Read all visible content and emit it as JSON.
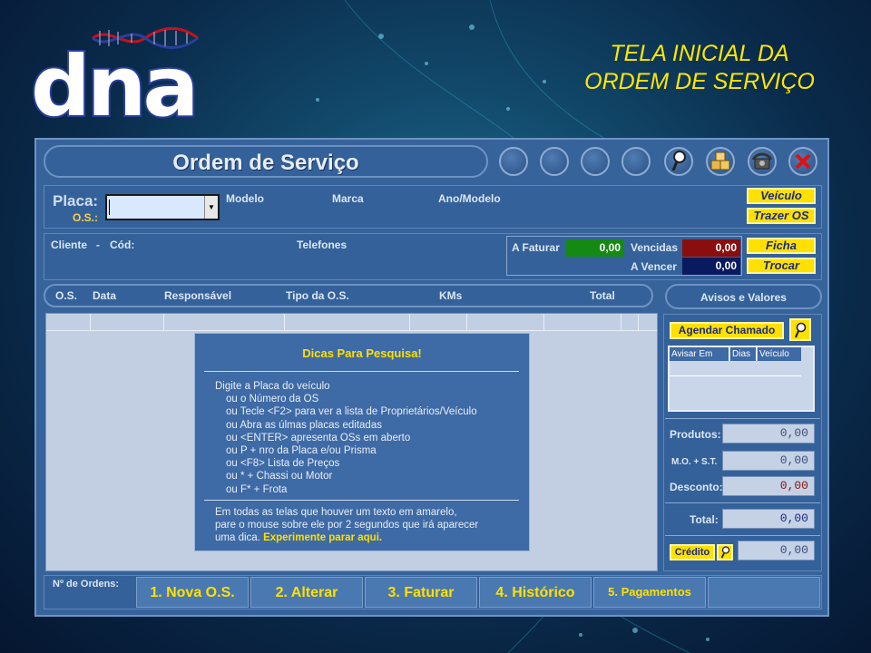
{
  "colors": {
    "accent_yellow": "#ffe000",
    "window_blue": "#37639b",
    "ok_green": "#148a14",
    "danger_red": "#8a0e0e",
    "navy": "#0a1a5e"
  },
  "logo": {
    "text": "dna"
  },
  "headline": {
    "line1": "TELA INICIAL DA",
    "line2": "ORDEM DE SERVIÇO"
  },
  "window": {
    "title": "Ordem de Serviço",
    "title_icons": [
      "search-icon",
      "boxes-icon",
      "phone-icon",
      "close-icon"
    ]
  },
  "vehicle": {
    "placa_label": "Placa:",
    "os_label": "O.S.:",
    "placa_value": "",
    "modelo_label": "Modelo",
    "marca_label": "Marca",
    "ano_label": "Ano/Modelo",
    "veiculo_btn": "Veículo",
    "trazer_btn": "Trazer OS"
  },
  "client": {
    "cliente_label": "Cliente",
    "dash": "-",
    "cod_label": "Cód:",
    "telefones_label": "Telefones",
    "a_faturar_label": "A Faturar",
    "a_faturar_value": "0,00",
    "vencidas_label": "Vencidas",
    "vencidas_value": "0,00",
    "a_vencer_label": "A Vencer",
    "a_vencer_value": "0,00",
    "ficha_btn": "Ficha",
    "trocar_btn": "Trocar"
  },
  "list": {
    "columns": [
      "O.S.",
      "Data",
      "Responsável",
      "Tipo da O.S.",
      "KMs",
      "Total"
    ]
  },
  "tips": {
    "title": "Dicas Para Pesquisa!",
    "lines": [
      "Digite a Placa do veículo",
      "ou  o Número da OS",
      "ou Tecle <F2> para ver a lista de Proprietários/Veículo",
      "ou Abra as úlmas placas editadas",
      "ou <ENTER> apresenta OSs em aberto",
      "ou P + nro da Placa e/ou Prisma",
      "ou <F8> Lista de Preços",
      "ou * + Chassi ou Motor",
      "ou F* + Frota"
    ],
    "footer1": "Em todas as  telas que houver um texto em amarelo,",
    "footer2": "pare o mouse sobre ele por 2 segundos que irá aparecer",
    "footer3_plain": "uma dica.",
    "footer3_yellow": "Experimente parar aqui."
  },
  "avisos": {
    "header_a": "Avisos",
    "header_e": "e",
    "header_b": "Valores",
    "agendar_btn": "Agendar Chamado",
    "columns": [
      "Avisar Em",
      "Dias",
      "Veículo"
    ]
  },
  "totals": {
    "produtos_label": "Produtos:",
    "produtos_value": "0,00",
    "mo_label": "M.O. + S.T.",
    "mo_value": "0,00",
    "desconto_label": "Desconto:",
    "desconto_value": "0,00",
    "total_label": "Total:",
    "total_value": "0,00",
    "credito_btn": "Crédito",
    "credito_value": "0,00"
  },
  "footer": {
    "ordens_label": "Nº de Ordens:",
    "nav": [
      "1. Nova O.S.",
      "2. Alterar",
      "3. Faturar",
      "4. Histórico",
      "5. Pagamentos"
    ]
  }
}
